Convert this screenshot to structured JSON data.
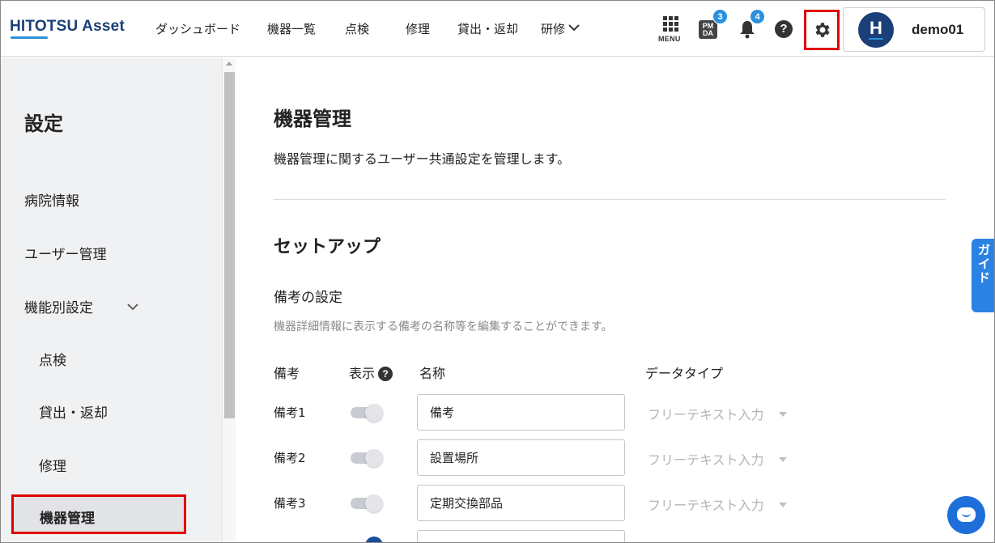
{
  "header": {
    "logo_main": "HITOTSU Asse",
    "logo_tail": "t",
    "nav": [
      "ダッシュボード",
      "機器一覧",
      "点検",
      "修理",
      "貸出・返却",
      "研修"
    ],
    "menu_label": "MENU",
    "pmda_icon_text": "PMDA",
    "pmda_badge": "3",
    "bell_badge": "4",
    "help_glyph": "?",
    "user_initial": "H",
    "username": "demo01"
  },
  "sidebar": {
    "title": "設定",
    "items": [
      "病院情報",
      "ユーザー管理",
      "機能別設定",
      "点検",
      "貸出・返却",
      "修理",
      "機器管理"
    ],
    "active_item": "機器管理"
  },
  "main": {
    "title": "機器管理",
    "description": "機器管理に関するユーザー共通設定を管理します。",
    "section_title": "セットアップ",
    "subsection_title": "備考の設定",
    "subsection_desc": "機器詳細情報に表示する備考の名称等を編集することができます。",
    "columns": {
      "remark": "備考",
      "display": "表示",
      "name": "名称",
      "data_type": "データタイプ"
    },
    "rows": [
      {
        "label": "備考1",
        "name": "備考",
        "data_type": "フリーテキスト入力",
        "display_on": true
      },
      {
        "label": "備考2",
        "name": "設置場所",
        "data_type": "フリーテキスト入力",
        "display_on": true
      },
      {
        "label": "備考3",
        "name": "定期交換部品",
        "data_type": "フリーテキスト入力",
        "display_on": true
      }
    ]
  },
  "guide_tab": [
    "ガ",
    "イ",
    "ド"
  ],
  "colors": {
    "brand": "#1b3f78",
    "accent": "#2a90e0",
    "highlight": "#e00000"
  },
  "icons": [
    "menu-grid-icon",
    "pmda-icon",
    "bell-icon",
    "help-icon",
    "gear-icon",
    "chevron-down-icon",
    "chat-icon"
  ]
}
